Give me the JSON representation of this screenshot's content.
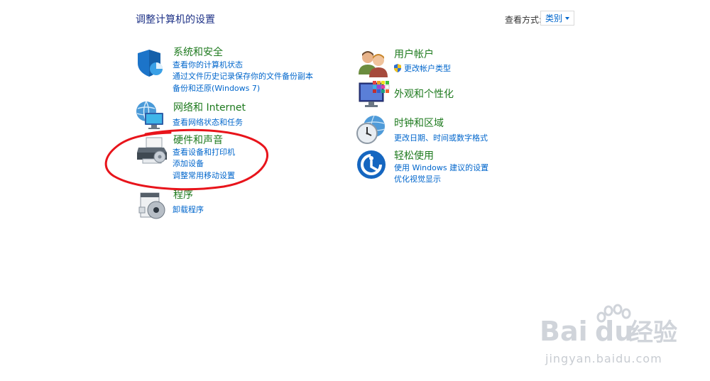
{
  "page_title": "调整计算机的设置",
  "view_by": {
    "label": "查看方式:",
    "selected": "类别"
  },
  "categories": {
    "system": {
      "title": "系统和安全",
      "links": [
        "查看你的计算机状态",
        "通过文件历史记录保存你的文件备份副本",
        "备份和还原(Windows 7)"
      ]
    },
    "network": {
      "title": "网络和 Internet",
      "links": [
        "查看网络状态和任务"
      ]
    },
    "hardware": {
      "title": "硬件和声音",
      "links": [
        "查看设备和打印机",
        "添加设备",
        "调整常用移动设置"
      ]
    },
    "programs": {
      "title": "程序",
      "links": [
        "卸载程序"
      ]
    },
    "accounts": {
      "title": "用户帐户",
      "links": [
        "更改帐户类型"
      ]
    },
    "appearance": {
      "title": "外观和个性化",
      "links": []
    },
    "clock": {
      "title": "时钟和区域",
      "links": [
        "更改日期、时间或数字格式"
      ]
    },
    "ease": {
      "title": "轻松使用",
      "links": [
        "使用 Windows 建议的设置",
        "优化视觉显示"
      ]
    }
  },
  "annotation": {
    "color": "#e8141b",
    "highlight": "hardware"
  },
  "watermark": {
    "text": "Bai",
    "text2": "du",
    "text_cn": "经验",
    "url": "jingyan.baidu.com"
  },
  "icons": [
    "shield-icon",
    "network-globe-icon",
    "printer-icon",
    "programs-disc-icon",
    "users-icon",
    "uac-shield-icon",
    "monitor-palette-icon",
    "clock-globe-icon",
    "ease-of-access-icon",
    "baidu-paw-icon"
  ],
  "colors": {
    "title": "#1e3287",
    "category": "#1e7a1e",
    "link": "#0066cc"
  }
}
